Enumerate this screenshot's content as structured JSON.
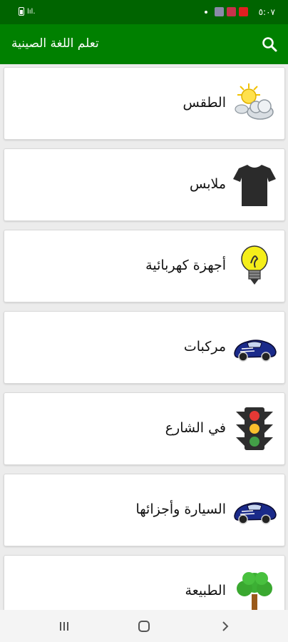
{
  "status_bar": {
    "time": "٥:٠٧",
    "signal_text": "lıl."
  },
  "app_bar": {
    "title": "تعلم اللغة الصينية",
    "search_icon": "search-icon"
  },
  "categories": [
    {
      "label": "الطقس",
      "icon": "weather-icon"
    },
    {
      "label": "ملابس",
      "icon": "tshirt-icon"
    },
    {
      "label": "أجهزة كهربائية",
      "icon": "lightbulb-icon"
    },
    {
      "label": "مركبات",
      "icon": "car-icon"
    },
    {
      "label": "في الشارع",
      "icon": "traffic-light-icon"
    },
    {
      "label": "السيارة وأجزائها",
      "icon": "car-icon"
    },
    {
      "label": "الطبيعة",
      "icon": "tree-icon"
    }
  ],
  "nav_bar": {
    "buttons": [
      "recent-apps-icon",
      "home-icon",
      "back-icon"
    ]
  },
  "colors": {
    "status_bar": "#006400",
    "app_bar": "#008000",
    "background": "#ececec"
  }
}
